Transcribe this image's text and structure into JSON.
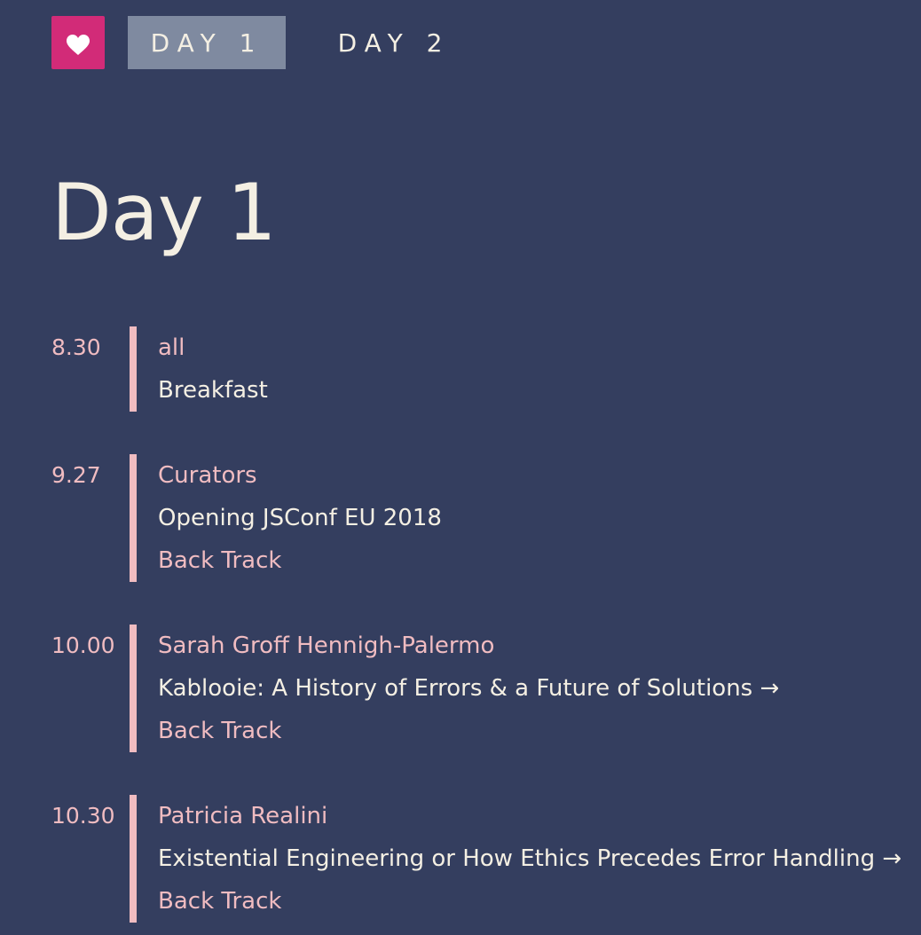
{
  "nav": {
    "tabs": [
      {
        "label": "DAY 1",
        "active": true
      },
      {
        "label": "DAY 2",
        "active": false
      }
    ]
  },
  "page": {
    "title": "Day 1"
  },
  "schedule": [
    {
      "time": "8.30",
      "speaker": "all",
      "title": "Breakfast"
    },
    {
      "time": "9.27",
      "speaker": "Curators",
      "title": "Opening JSConf EU 2018",
      "track": "Back Track"
    },
    {
      "time": "10.00",
      "speaker": "Sarah Groff Hennigh-Palermo",
      "title": "Kablooie: A History of Errors & a Future of Solutions →",
      "track": "Back Track"
    },
    {
      "time": "10.30",
      "speaker": "Patricia Realini",
      "title": "Existential Engineering or How Ethics Precedes Error Handling →",
      "track": "Back Track"
    }
  ],
  "colors": {
    "background": "#343e5f",
    "accent_pink": "#f0bcc1",
    "logo": "#d22b78",
    "text": "#f4efe3",
    "active_tab": "#7f8aa0"
  },
  "icons": {
    "logo": "heart-icon"
  }
}
